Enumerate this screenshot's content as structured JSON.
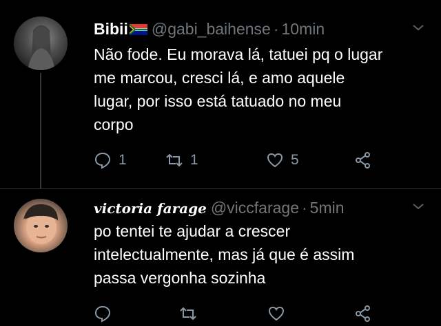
{
  "tweets": [
    {
      "name": "Bibii",
      "handle": "@gabi_baihense",
      "separator": "·",
      "time": "10min",
      "lines": [
        "Não fode. Eu morava lá, tatuei pq o lugar",
        "me marcou, cresci lá, e amo aquele",
        "lugar, por isso está tatuado no meu",
        "corpo"
      ],
      "replies": "1",
      "retweets": "1",
      "likes": "5",
      "icons": [
        "reply-icon",
        "retweet-icon",
        "like-icon",
        "share-icon"
      ]
    },
    {
      "name": "victoria farage",
      "handle": "@viccfarage",
      "separator": "·",
      "time": "5min",
      "lines": [
        "po tentei te ajudar a crescer",
        "intelectualmente, mas já que é assim",
        "passa vergonha sozinha"
      ],
      "replies": "",
      "retweets": "",
      "likes": "",
      "icons": [
        "reply-icon",
        "retweet-icon",
        "like-icon",
        "share-icon"
      ]
    }
  ],
  "colors": {
    "background": "#000000",
    "text": "#ffffff",
    "muted": "#71767b",
    "icon": "#8b98a5"
  }
}
